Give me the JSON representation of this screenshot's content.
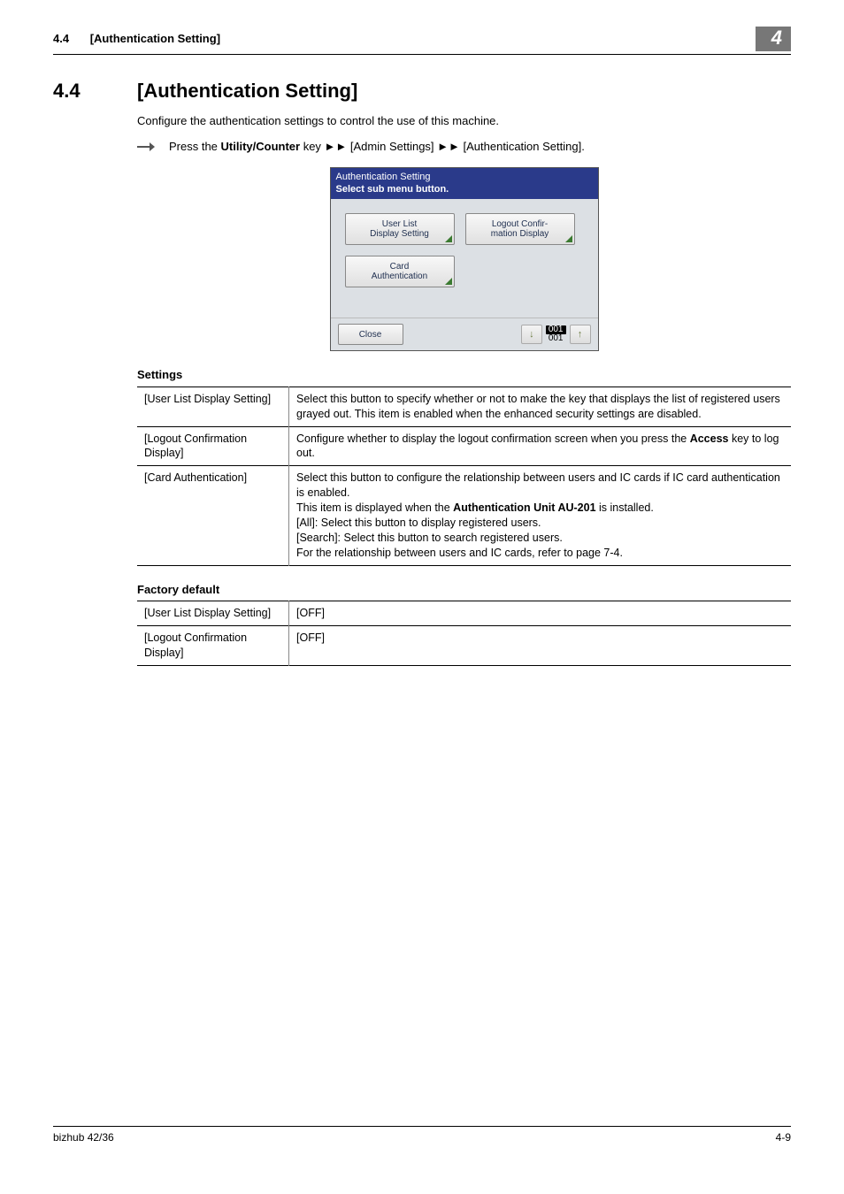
{
  "header": {
    "section_number": "4.4",
    "section_title_short": "[Authentication Setting]",
    "chapter_number": "4"
  },
  "section": {
    "number": "4.4",
    "title": "[Authentication Setting]",
    "intro": "Configure the authentication settings to control the use of this machine.",
    "nav_prefix": "Press the ",
    "nav_bold1": "Utility/Counter",
    "nav_mid1": " key ►► [Admin Settings] ►► [Authentication Setting]."
  },
  "device": {
    "header_line1": "Authentication Setting",
    "header_line2": "Select sub menu button.",
    "buttons": [
      "User List\nDisplay Setting",
      "Logout Confir-\nmation Display",
      "Card\nAuthentication"
    ],
    "close": "Close",
    "page_current": "001",
    "page_total": "001"
  },
  "settings": {
    "heading": "Settings",
    "rows": [
      {
        "name": "[User List Display Setting]",
        "desc": "Select this button to specify whether or not to make the key that displays the list of registered users grayed out. This item is enabled when the enhanced security settings are disabled."
      },
      {
        "name": "[Logout Confirmation Display]",
        "desc_pre": "Configure whether to display the logout confirmation screen when you press the ",
        "desc_bold": "Access",
        "desc_post": " key to log out."
      },
      {
        "name": "[Card Authentication]",
        "desc_l1": "Select this button to configure the relationship between users and IC cards if IC card authentication is enabled.",
        "desc_l2_pre": "This item is displayed when the ",
        "desc_l2_bold": "Authentication Unit AU-201",
        "desc_l2_post": " is installed.",
        "desc_l3": "[All]: Select this button to display registered users.",
        "desc_l4": "[Search]: Select this button to search registered users.",
        "desc_l5": "For the relationship between users and IC cards, refer to page 7-4."
      }
    ]
  },
  "defaults": {
    "heading": "Factory default",
    "rows": [
      {
        "name": "[User List Display Setting]",
        "value": "[OFF]"
      },
      {
        "name": "[Logout Confirmation Display]",
        "value": "[OFF]"
      }
    ]
  },
  "footer": {
    "left": "bizhub 42/36",
    "right": "4-9"
  }
}
